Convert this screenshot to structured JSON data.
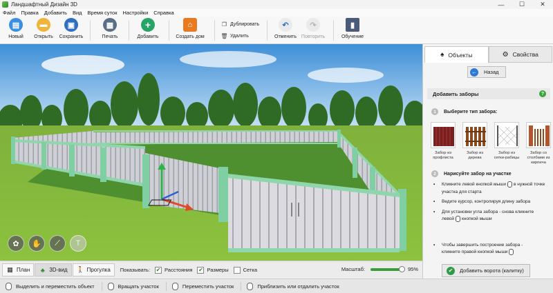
{
  "window": {
    "title": "Ландшафтный Дизайн 3D",
    "minimize": "—",
    "maximize": "☐",
    "close": "✕"
  },
  "menu": [
    "Файл",
    "Правка",
    "Добавить",
    "Вид",
    "Время суток",
    "Настройки",
    "Справка"
  ],
  "toolbar": {
    "new": "Новый",
    "open": "Открыть",
    "save": "Сохранить",
    "print": "Печать",
    "add": "Добавить",
    "create_house": "Создать дом",
    "duplicate": "Дублировать",
    "delete": "Удалить",
    "undo": "Отменить",
    "redo": "Повторить",
    "tutorial": "Обучение"
  },
  "viewbar": {
    "tabs": [
      {
        "label": "План",
        "active": false
      },
      {
        "label": "3D-вид",
        "active": true
      },
      {
        "label": "Прогулка",
        "active": false
      }
    ],
    "show_label": "Показывать:",
    "checkboxes": [
      {
        "label": "Расстояния",
        "checked": true
      },
      {
        "label": "Размеры",
        "checked": true
      },
      {
        "label": "Сетка",
        "checked": false
      }
    ],
    "scale_label": "Масштаб:",
    "scale_value": "95%",
    "scale_fraction": 0.95
  },
  "statusbar": [
    "Выделить и переместить объект",
    "Вращать участок",
    "Переместить участок",
    "Приблизить или отдалить участок"
  ],
  "panel": {
    "tabs": [
      {
        "label": "Объекты",
        "active": true
      },
      {
        "label": "Свойства",
        "active": false
      }
    ],
    "back": "Назад",
    "section_title": "Добавить заборы",
    "help": "?",
    "step1": {
      "num": "1",
      "label": "Выберите тип забора:"
    },
    "fence_types": [
      "Забор из профлиста",
      "Забор из дерева",
      "Забор из сетки-рабицы",
      "Забор со столбами из кирпича"
    ],
    "step2": {
      "num": "2",
      "label": "Нарисуйте забор на участке"
    },
    "instructions": [
      {
        "a": "Кликните левой кнопкой мыши",
        "b": "в нужной точке участка для старта"
      },
      {
        "a": "Ведите курсор, контролируя длину забора",
        "b": ""
      },
      {
        "a": "Для установки угла забора - снова кликните левой",
        "b": "кнопкой мыши"
      }
    ],
    "finish": {
      "a": "Чтобы завершить построение забора -",
      "b": "кликните правой кнопкой мыши"
    },
    "add_gate": "Добавить ворота (калитку)"
  },
  "colors": {
    "accent_green": "#2e9a45",
    "accent_blue": "#2c7ad6",
    "fence_trim": "#7fcfa3",
    "fence_boards": "#d8d8dc"
  }
}
